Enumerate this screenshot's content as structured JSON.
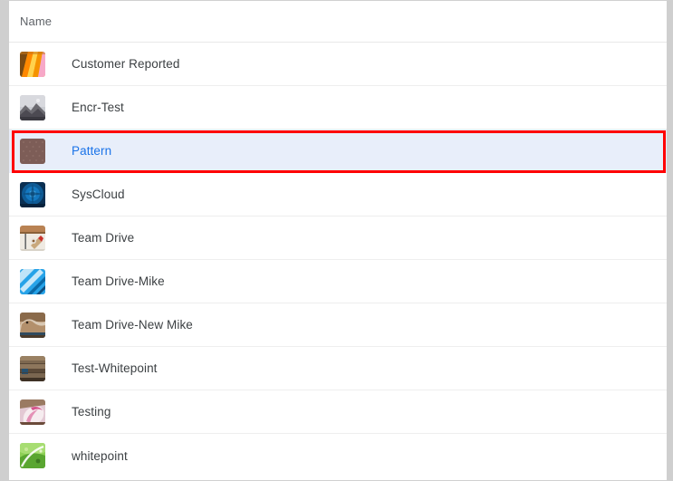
{
  "window": {
    "title": "Drive file list",
    "border_color": "#cfcfcf"
  },
  "table": {
    "columns": [
      {
        "key": "name",
        "label": "Name"
      }
    ],
    "selected_row_index": 2,
    "selection_bg": "#e8eefa",
    "selected_text_color": "#1a73e8",
    "row_text_color": "#3c4043",
    "rows": [
      {
        "name": "Customer Reported",
        "thumbnail": {
          "icon": "folder-thumbnail-orange-stripes",
          "colors": [
            "#f5a623",
            "#ffcc00",
            "#ff8800",
            "#f7a8c8",
            "#7a4a12"
          ]
        }
      },
      {
        "name": "Encr-Test",
        "thumbnail": {
          "icon": "folder-thumbnail-landscape-photo",
          "colors": [
            "#b9bcc4",
            "#8e8d92",
            "#4c4a52",
            "#d8d9de",
            "#6b6a70"
          ]
        }
      },
      {
        "name": "Pattern",
        "thumbnail": {
          "icon": "folder-thumbnail-brown-dotted",
          "colors": [
            "#7a5b56",
            "#8a6a64",
            "#6b4d48"
          ]
        }
      },
      {
        "name": "SysCloud",
        "thumbnail": {
          "icon": "folder-thumbnail-blue-burst",
          "colors": [
            "#0b4d87",
            "#1478c0",
            "#0a2f52",
            "#3aa0e0"
          ]
        }
      },
      {
        "name": "Team Drive",
        "thumbnail": {
          "icon": "folder-thumbnail-tools-wood",
          "colors": [
            "#b98253",
            "#e8e3dc",
            "#8a6038",
            "#c9342c",
            "#6d6d6d"
          ]
        }
      },
      {
        "name": "Team Drive-Mike",
        "thumbnail": {
          "icon": "folder-thumbnail-blue-diagonal",
          "colors": [
            "#27a3e8",
            "#bfe4f8",
            "#0a6aa8",
            "#ffffff"
          ]
        }
      },
      {
        "name": "Team Drive-New Mike",
        "thumbnail": {
          "icon": "folder-thumbnail-animal-photo",
          "colors": [
            "#8a6a4a",
            "#c7a98a",
            "#4a3a2a",
            "#d9c9b5",
            "#2f4a5e"
          ]
        }
      },
      {
        "name": "Test-Whitepoint",
        "thumbnail": {
          "icon": "folder-thumbnail-wood-texture",
          "colors": [
            "#6b5742",
            "#9a8163",
            "#3e3125",
            "#26506e"
          ]
        }
      },
      {
        "name": "Testing",
        "thumbnail": {
          "icon": "folder-thumbnail-pink-flower",
          "colors": [
            "#e8c7d6",
            "#d4548c",
            "#f3e6ea",
            "#6b4b3a",
            "#9a7a62"
          ]
        }
      },
      {
        "name": "whitepoint",
        "thumbnail": {
          "icon": "folder-thumbnail-green-leaf",
          "colors": [
            "#8dcf55",
            "#5aa631",
            "#c8e89a",
            "#ffffff",
            "#3d7a22"
          ]
        }
      }
    ]
  },
  "annotation": {
    "type": "highlight-rectangle",
    "color": "#ff0000",
    "target_row": "Pattern"
  }
}
